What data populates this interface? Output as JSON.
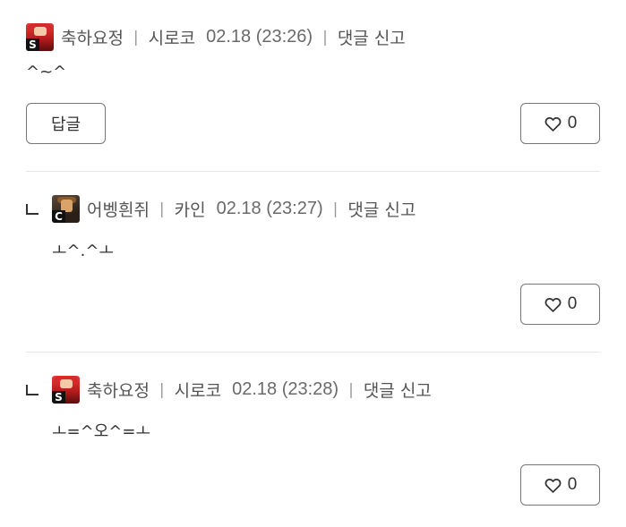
{
  "labels": {
    "separator": "|",
    "report": "댓글 신고",
    "reply_button": "답글"
  },
  "comments": [
    {
      "nickname": "축하요정",
      "server": "시로코",
      "datetime": "02.18 (23:26)",
      "avatar_badge": "S",
      "text": "^~^",
      "likes": "0"
    },
    {
      "nickname": "어벵흰쥐",
      "server": "카인",
      "datetime": "02.18 (23:27)",
      "avatar_badge": "C",
      "text": "ㅗ^.^ㅗ",
      "likes": "0"
    },
    {
      "nickname": "축하요정",
      "server": "시로코",
      "datetime": "02.18 (23:28)",
      "avatar_badge": "S",
      "text": "ㅗ=^오^=ㅗ",
      "likes": "0"
    }
  ],
  "icons": {
    "like": "heart-outline-icon",
    "reply_marker": "reply-arrow-icon"
  },
  "colors": {
    "text": "#333333",
    "muted": "#6a6a6a",
    "border": "#777777",
    "divider": "#e6e6e6"
  }
}
